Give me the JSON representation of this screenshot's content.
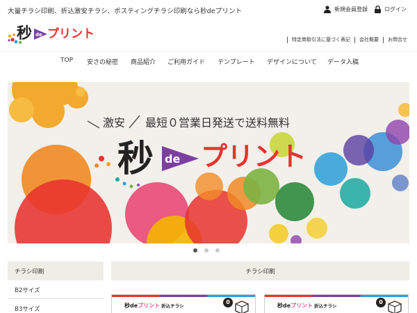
{
  "header": {
    "tagline": "大量チラシ印刷、折込激安チラシ、ポスティングチラシ印刷なら秒deプリント",
    "register_label": "新規会員登録",
    "login_label": "ログイン"
  },
  "logo": {
    "kanji": "秒",
    "de": "de",
    "kana": "プリント"
  },
  "subnav": {
    "items": [
      "特定商取引法に基づく表記",
      "会社概要",
      "お問合せ"
    ]
  },
  "mainnav": {
    "items": [
      "TOP",
      "安さの秘密",
      "商品紹介",
      "ご利用ガイド",
      "テンプレート",
      "デザインについて",
      "データ入稿"
    ]
  },
  "hero": {
    "tagline_left": "激安",
    "tagline_right": "最短０営業日発送で送料無料",
    "logo_kanji": "秒",
    "logo_de": "de",
    "logo_kana": "プリント"
  },
  "carousel": {
    "count": 3,
    "active": 1
  },
  "sidebar": {
    "heading": "チラシ印刷",
    "items": [
      "B2サイズ",
      "B3サイズ"
    ]
  },
  "section": {
    "title": "チラシ印刷"
  },
  "cards": [
    {
      "brand": "秒de",
      "brand_kana": "プリント",
      "kind": "折込チラシ",
      "size_text": "B2",
      "badge": "0"
    },
    {
      "brand": "秒de",
      "brand_kana": "プリント",
      "kind": "折込チラシ",
      "size_text": "B3",
      "badge": "0"
    }
  ],
  "colors": {
    "accent_purple": "#7b3fa0",
    "accent_red": "#e8332e",
    "accent_pink": "#e64c8b",
    "panel_beige": "#f0ece6"
  }
}
